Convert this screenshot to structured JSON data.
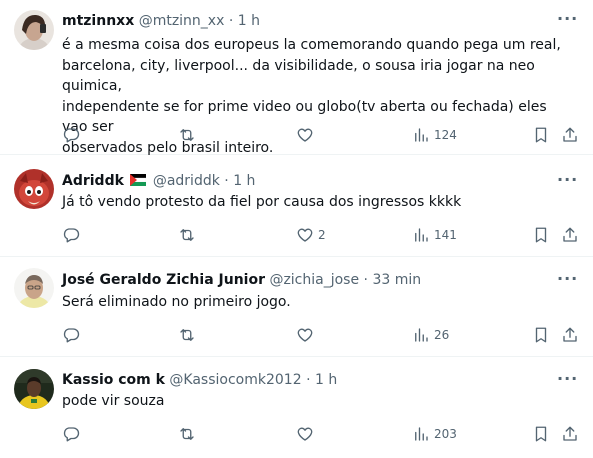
{
  "tweets": [
    {
      "name": "mtzinnxx",
      "handle": "@mtzinn_xx",
      "sep": "·",
      "time": "1 h",
      "text_lines": [
        "é a mesma coisa dos europeus la comemorando quando pega um real,",
        "barcelona, city, liverpool... da visibilidade, o sousa iria jogar na neo quimica,",
        "independente se for prime video ou globo(tv aberta ou fechada) eles vao ser",
        "observados pelo brasil inteiro."
      ],
      "likes": "",
      "views": "124"
    },
    {
      "name": "Adriddk",
      "handle": "@adriddk",
      "sep": "·",
      "time": "1 h",
      "text_lines": [
        "Já tô vendo protesto da fiel por causa dos ingressos kkkk"
      ],
      "likes": "2",
      "views": "141"
    },
    {
      "name": "José Geraldo Zichia Junior",
      "handle": "@zichia_jose",
      "sep": "·",
      "time": "33 min",
      "text_lines": [
        "Será eliminado no primeiro jogo."
      ],
      "likes": "",
      "views": "26"
    },
    {
      "name": "Kassio com k",
      "handle": "@Kassiocomk2012",
      "sep": "·",
      "time": "1 h",
      "text_lines": [
        "pode vir souza"
      ],
      "likes": "",
      "views": "203"
    }
  ],
  "more_glyph": "···",
  "icons": [
    "reply-icon",
    "retweet-icon",
    "like-icon",
    "views-icon",
    "bookmark-icon",
    "share-icon"
  ],
  "colors": {
    "text": "#0f1419",
    "secondary": "#536471",
    "divider": "#eff3f4"
  }
}
